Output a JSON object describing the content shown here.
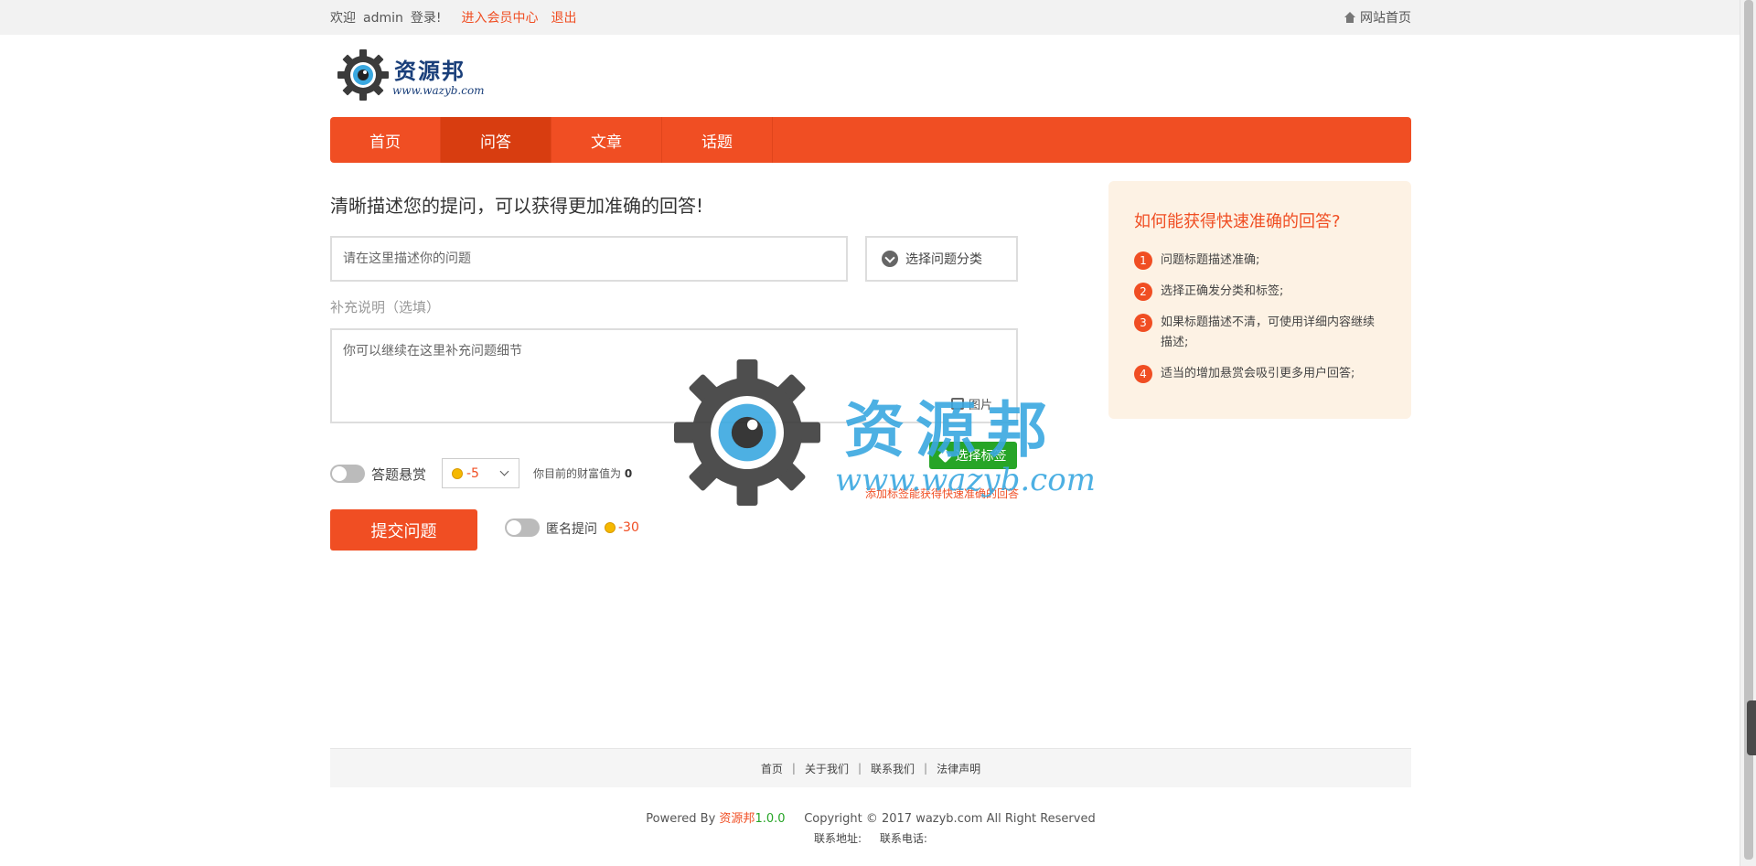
{
  "topbar": {
    "welcome": "欢迎",
    "username": "admin",
    "login_suffix": "登录!",
    "member_center": "进入会员中心",
    "logout": "退出",
    "site_home": "网站首页"
  },
  "logo": {
    "title": "资源邦",
    "url": "www.wazyb.com"
  },
  "nav": {
    "items": [
      {
        "label": "首页",
        "active": false
      },
      {
        "label": "问答",
        "active": true
      },
      {
        "label": "文章",
        "active": false
      },
      {
        "label": "话题",
        "active": false
      }
    ]
  },
  "form": {
    "heading": "清晰描述您的提问，可以获得更加准确的回答!",
    "question_placeholder": "请在这里描述你的问题",
    "category_label": "选择问题分类",
    "supplement_label": "补充说明（选填）",
    "detail_placeholder": "你可以继续在这里补充问题细节",
    "image_label": "图片",
    "tag_button": "选择标签",
    "tag_hint": "添加标签能获得快速准确的回答",
    "reward_label": "答题悬赏",
    "reward_value": "-5",
    "wealth_text": "你目前的财富值为",
    "wealth_value": "0",
    "submit_label": "提交问题",
    "anonymous_label": "匿名提问",
    "anonymous_cost": "-30"
  },
  "watermark": {
    "title": "资源邦",
    "url": "www.wazyb.com"
  },
  "tips": {
    "title": "如何能获得快速准确的回答?",
    "items": [
      {
        "num": "1",
        "text": "问题标题描述准确;"
      },
      {
        "num": "2",
        "text": "选择正确发分类和标签;"
      },
      {
        "num": "3",
        "text": "如果标题描述不清，可使用详细内容继续描述;"
      },
      {
        "num": "4",
        "text": "适当的增加悬赏会吸引更多用户回答;"
      }
    ]
  },
  "footer": {
    "links": [
      "首页",
      "关于我们",
      "联系我们",
      "法律声明"
    ],
    "separator": "|",
    "powered_by": "Powered By",
    "brand": "资源邦",
    "version": "1.0.0",
    "copyright": "Copyright © 2017 wazyb.com All Right Reserved",
    "address_label": "联系地址:",
    "phone_label": "联系电话:"
  },
  "colors": {
    "accent": "#f04e23",
    "nav_active": "#d83d10",
    "tag_green": "#27a527",
    "tips_bg": "#fdf2e4",
    "logo_blue": "#1a3f7a",
    "watermark_blue": "#3aa8e0"
  }
}
